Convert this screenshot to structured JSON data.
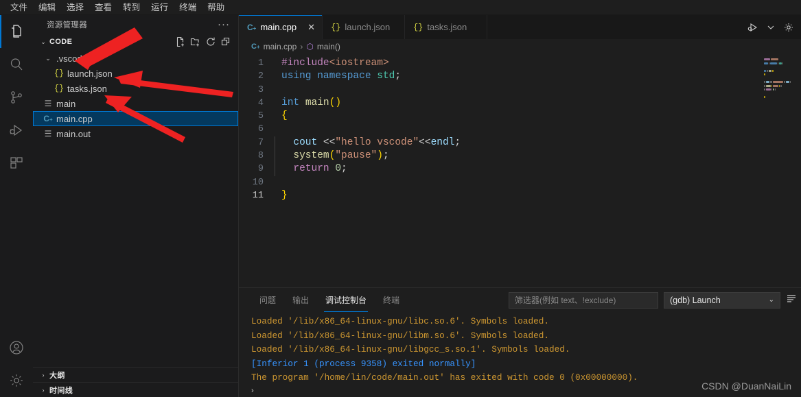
{
  "menubar": {
    "items": [
      {
        "label": "文件"
      },
      {
        "label": "编辑"
      },
      {
        "label": "选择"
      },
      {
        "label": "查看"
      },
      {
        "label": "转到"
      },
      {
        "label": "运行"
      },
      {
        "label": "终端"
      },
      {
        "label": "帮助"
      }
    ]
  },
  "activitybar": {
    "items": [
      {
        "name": "explorer",
        "icon": "files-icon",
        "active": true
      },
      {
        "name": "search",
        "icon": "search-icon",
        "active": false
      },
      {
        "name": "source-control",
        "icon": "source-control-icon",
        "active": false
      },
      {
        "name": "run-debug",
        "icon": "run-debug-icon",
        "active": false
      },
      {
        "name": "extensions",
        "icon": "extensions-icon",
        "active": false
      }
    ],
    "bottom": [
      {
        "name": "account",
        "icon": "account-icon"
      },
      {
        "name": "settings",
        "icon": "gear-icon"
      }
    ]
  },
  "sidebar": {
    "title": "资源管理器",
    "overflow_label": "···",
    "section": {
      "label": "CODE",
      "caret": "⌄",
      "actions": [
        {
          "name": "new-file",
          "icon": "new-file-icon"
        },
        {
          "name": "new-folder",
          "icon": "new-folder-icon"
        },
        {
          "name": "refresh",
          "icon": "refresh-icon"
        },
        {
          "name": "collapse-all",
          "icon": "collapse-all-icon"
        }
      ]
    },
    "tree": [
      {
        "label": ".vscode",
        "type": "folder",
        "indent": 1,
        "caret": "⌄",
        "icon": "",
        "selected": false
      },
      {
        "label": "launch.json",
        "type": "json",
        "indent": 2,
        "caret": "",
        "icon": "{}",
        "selected": false
      },
      {
        "label": "tasks.json",
        "type": "json",
        "indent": 2,
        "caret": "",
        "icon": "{}",
        "selected": false
      },
      {
        "label": "main",
        "type": "binary",
        "indent": 1,
        "caret": "",
        "icon": "☰",
        "selected": false
      },
      {
        "label": "main.cpp",
        "type": "cpp",
        "indent": 1,
        "caret": "",
        "icon": "C",
        "selected": true
      },
      {
        "label": "main.out",
        "type": "binary",
        "indent": 1,
        "caret": "",
        "icon": "☰",
        "selected": false
      }
    ],
    "bottom_sections": [
      {
        "label": "大纲",
        "caret": "›"
      },
      {
        "label": "时间线",
        "caret": "›"
      }
    ]
  },
  "editor": {
    "tabs": [
      {
        "label": "main.cpp",
        "icon": "cpp-file-icon",
        "active": true,
        "close": "✕"
      },
      {
        "label": "launch.json",
        "icon": "json-file-icon",
        "active": false,
        "close": ""
      },
      {
        "label": "tasks.json",
        "icon": "json-file-icon",
        "active": false,
        "close": ""
      }
    ],
    "tab_actions": [
      {
        "name": "run-or-debug",
        "icon": "run-play-icon"
      },
      {
        "name": "chevron-down",
        "icon": "chevron-down-icon"
      },
      {
        "name": "settings",
        "icon": "gear-icon"
      }
    ],
    "breadcrumb": {
      "file": "main.cpp",
      "separator": "›",
      "symbol": "main()"
    },
    "lines": [
      {
        "num": "1",
        "tokens": [
          {
            "t": "#include",
            "c": "k-pre"
          },
          {
            "t": "<iostream>",
            "c": "k-inc"
          }
        ]
      },
      {
        "num": "2",
        "tokens": [
          {
            "t": "using",
            "c": "k-kw"
          },
          {
            "t": " ",
            "c": "k-plain"
          },
          {
            "t": "namespace",
            "c": "k-kw"
          },
          {
            "t": " ",
            "c": "k-plain"
          },
          {
            "t": "std",
            "c": "k-ns"
          },
          {
            "t": ";",
            "c": "k-plain"
          }
        ]
      },
      {
        "num": "3",
        "tokens": []
      },
      {
        "num": "4",
        "tokens": [
          {
            "t": "int",
            "c": "k-type"
          },
          {
            "t": " ",
            "c": "k-plain"
          },
          {
            "t": "main",
            "c": "k-fn"
          },
          {
            "t": "()",
            "c": "k-brz"
          }
        ]
      },
      {
        "num": "5",
        "tokens": [
          {
            "t": "{",
            "c": "k-brz"
          }
        ]
      },
      {
        "num": "6",
        "tokens": []
      },
      {
        "num": "7",
        "tokens": [
          {
            "t": "  ",
            "c": "k-plain"
          },
          {
            "t": "cout",
            "c": "k-var"
          },
          {
            "t": " <<",
            "c": "k-plain"
          },
          {
            "t": "\"hello vscode\"",
            "c": "k-str"
          },
          {
            "t": "<<",
            "c": "k-plain"
          },
          {
            "t": "endl",
            "c": "k-var"
          },
          {
            "t": ";",
            "c": "k-plain"
          }
        ]
      },
      {
        "num": "8",
        "tokens": [
          {
            "t": "  ",
            "c": "k-plain"
          },
          {
            "t": "system",
            "c": "k-fn"
          },
          {
            "t": "(",
            "c": "k-brz"
          },
          {
            "t": "\"pause\"",
            "c": "k-str"
          },
          {
            "t": ")",
            "c": "k-brz"
          },
          {
            "t": ";",
            "c": "k-plain"
          }
        ]
      },
      {
        "num": "9",
        "tokens": [
          {
            "t": "  ",
            "c": "k-plain"
          },
          {
            "t": "return",
            "c": "k-pre"
          },
          {
            "t": " ",
            "c": "k-plain"
          },
          {
            "t": "0",
            "c": "k-num"
          },
          {
            "t": ";",
            "c": "k-plain"
          }
        ]
      },
      {
        "num": "10",
        "tokens": []
      },
      {
        "num": "11",
        "tokens": [
          {
            "t": "}",
            "c": "k-brz"
          }
        ],
        "current": true
      }
    ]
  },
  "panel": {
    "tabs": [
      {
        "label": "问题",
        "active": false
      },
      {
        "label": "输出",
        "active": false
      },
      {
        "label": "调试控制台",
        "active": true
      },
      {
        "label": "终端",
        "active": false
      }
    ],
    "filter": {
      "value": "",
      "placeholder": "筛选器(例如 text、!exclude)"
    },
    "launch_config": {
      "selected": "(gdb) Launch",
      "chevron": "⌄"
    },
    "actions": [
      {
        "name": "clear-console",
        "icon": "clear-console-icon"
      }
    ],
    "console_lines": [
      {
        "text": "Loaded '/lib/x86_64-linux-gnu/libc.so.6'. Symbols loaded.",
        "color": "c-amber"
      },
      {
        "text": "Loaded '/lib/x86_64-linux-gnu/libm.so.6'. Symbols loaded.",
        "color": "c-amber"
      },
      {
        "text": "Loaded '/lib/x86_64-linux-gnu/libgcc_s.so.1'. Symbols loaded.",
        "color": "c-amber"
      },
      {
        "text": "[Inferior 1 (process 9358) exited normally]",
        "color": "c-blue"
      },
      {
        "text": "The program '/home/lin/code/main.out' has exited with code 0 (0x00000000).",
        "color": "c-amber"
      }
    ],
    "prompt_caret": "›"
  },
  "annotations": {
    "arrow_color": "#ee2222",
    "arrows": [
      {
        "name": "arrow-to-vscode-folder",
        "target": ".vscode"
      },
      {
        "name": "arrow-to-launch-json",
        "target": "launch.json"
      },
      {
        "name": "arrow-to-tasks-json",
        "target": "tasks.json"
      }
    ]
  },
  "watermark": {
    "text": "CSDN @DuanNaiLin"
  },
  "colors": {
    "accent": "#0078d4",
    "selection": "#04395e",
    "bg": "#1e1e1e",
    "sidebar_bg": "#1b1b1c",
    "arrow_red": "#ee2222"
  }
}
